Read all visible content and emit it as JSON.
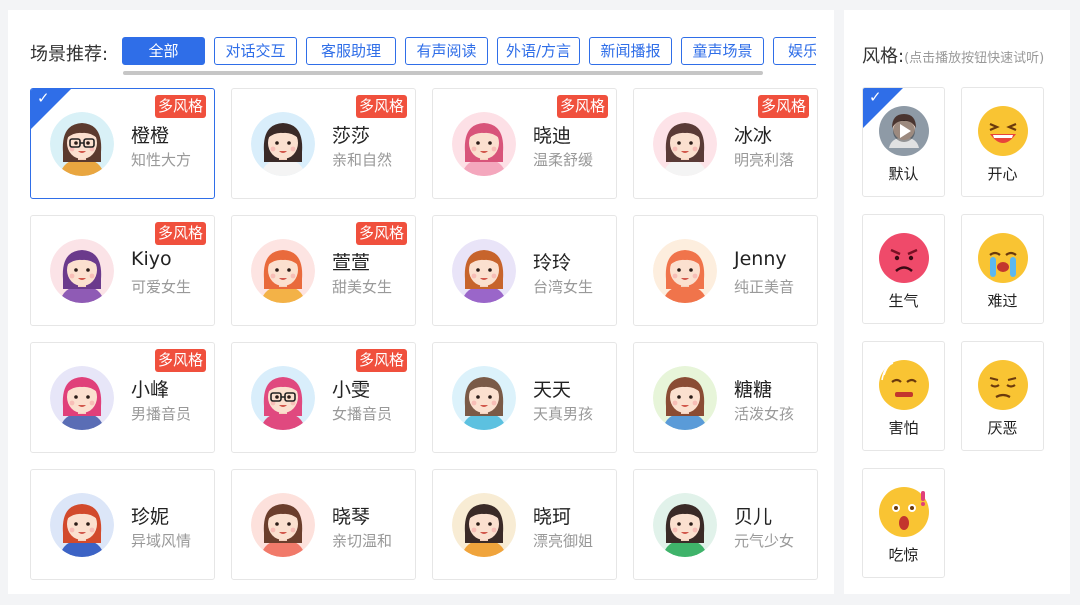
{
  "scene": {
    "label": "场景推荐:",
    "tabs": [
      {
        "label": "全部",
        "active": true
      },
      {
        "label": "对话交互",
        "active": false
      },
      {
        "label": "客服助理",
        "active": false
      },
      {
        "label": "有声阅读",
        "active": false
      },
      {
        "label": "外语/方言",
        "active": false
      },
      {
        "label": "新闻播报",
        "active": false
      },
      {
        "label": "童声场景",
        "active": false
      },
      {
        "label": "娱乐",
        "active": false
      }
    ]
  },
  "badge_label": "多风格",
  "voices": [
    {
      "name": "橙橙",
      "desc": "知性大方",
      "multi": true,
      "selected": true,
      "hair": "#5b3a2e",
      "bg": "#d9f1f7",
      "shirt": "#e9a640",
      "glasses": true
    },
    {
      "name": "莎莎",
      "desc": "亲和自然",
      "multi": true,
      "selected": false,
      "hair": "#3a2a27",
      "bg": "#d9eefb",
      "shirt": "#f4f4f4",
      "glasses": false
    },
    {
      "name": "晓迪",
      "desc": "温柔舒缓",
      "multi": true,
      "selected": false,
      "hair": "#d8547a",
      "bg": "#fde0e6",
      "shirt": "#f4a7bd",
      "glasses": false
    },
    {
      "name": "冰冰",
      "desc": "明亮利落",
      "multi": true,
      "selected": false,
      "hair": "#5a3b37",
      "bg": "#fde3e8",
      "shirt": "#f4f4f4",
      "glasses": false
    },
    {
      "name": "Kiyo",
      "desc": "可爱女生",
      "multi": true,
      "selected": false,
      "hair": "#6b3a8c",
      "bg": "#fbe3e7",
      "shirt": "#8f5bb5",
      "glasses": false
    },
    {
      "name": "萱萱",
      "desc": "甜美女生",
      "multi": true,
      "selected": false,
      "hair": "#e96a3c",
      "bg": "#fde4e2",
      "shirt": "#f3b247",
      "glasses": false
    },
    {
      "name": "玲玲",
      "desc": "台湾女生",
      "multi": false,
      "selected": false,
      "hair": "#c7642c",
      "bg": "#e9e4f8",
      "shirt": "#9a66c9",
      "glasses": false
    },
    {
      "name": "Jenny",
      "desc": "纯正美音",
      "multi": false,
      "selected": false,
      "hair": "#f0744b",
      "bg": "#fdeede",
      "shirt": "#f0744b",
      "glasses": false
    },
    {
      "name": "小峰",
      "desc": "男播音员",
      "multi": true,
      "selected": false,
      "hair": "#e0407a",
      "bg": "#e7e6f8",
      "shirt": "#5a6db5",
      "glasses": false
    },
    {
      "name": "小雯",
      "desc": "女播音员",
      "multi": true,
      "selected": false,
      "hair": "#e0497f",
      "bg": "#d9eefb",
      "shirt": "#e0497f",
      "glasses": true
    },
    {
      "name": "天天",
      "desc": "天真男孩",
      "multi": false,
      "selected": false,
      "hair": "#7a5a47",
      "bg": "#dcf2fb",
      "shirt": "#5cc1e0",
      "glasses": false
    },
    {
      "name": "糖糖",
      "desc": "活泼女孩",
      "multi": false,
      "selected": false,
      "hair": "#8a4c34",
      "bg": "#e7f5d9",
      "shirt": "#5a9bd8",
      "glasses": false
    },
    {
      "name": "珍妮",
      "desc": "异域风情",
      "multi": false,
      "selected": false,
      "hair": "#d24a2c",
      "bg": "#dce6f8",
      "shirt": "#3c63c5",
      "glasses": false
    },
    {
      "name": "晓琴",
      "desc": "亲切温和",
      "multi": false,
      "selected": false,
      "hair": "#6b3e2c",
      "bg": "#fde1dc",
      "shirt": "#f17a6a",
      "glasses": false
    },
    {
      "name": "晓珂",
      "desc": "漂亮御姐",
      "multi": false,
      "selected": false,
      "hair": "#3a2a27",
      "bg": "#f8ecd4",
      "shirt": "#f0a43c",
      "glasses": false
    },
    {
      "name": "贝儿",
      "desc": "元气少女",
      "multi": false,
      "selected": false,
      "hair": "#3a2a27",
      "bg": "#e1f2ea",
      "shirt": "#3fb36a",
      "glasses": false
    }
  ],
  "style_panel": {
    "label": "风格:",
    "hint": "(点击播放按钮快速试听)",
    "items": [
      {
        "name": "默认",
        "icon": "play-icon",
        "selected": true
      },
      {
        "name": "开心",
        "icon": "laughing-emoji-icon",
        "selected": false
      },
      {
        "name": "生气",
        "icon": "angry-emoji-icon",
        "selected": false
      },
      {
        "name": "难过",
        "icon": "crying-emoji-icon",
        "selected": false
      },
      {
        "name": "害怕",
        "icon": "scared-emoji-icon",
        "selected": false
      },
      {
        "name": "厌恶",
        "icon": "disgusted-emoji-icon",
        "selected": false
      },
      {
        "name": "吃惊",
        "icon": "surprised-emoji-icon",
        "selected": false
      }
    ]
  }
}
